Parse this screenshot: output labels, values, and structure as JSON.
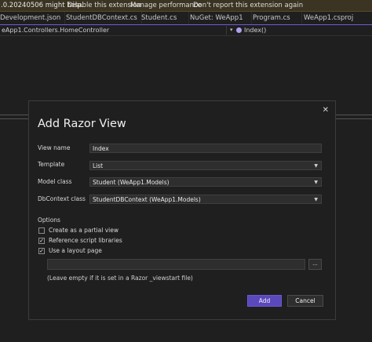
{
  "infobar": {
    "message": ".0.20240506 might help.",
    "links": [
      "Disable this extension",
      "Manage performance",
      "Don't report this extension again"
    ]
  },
  "tabs": [
    "Development.json",
    "StudentDBContext.cs",
    "Student.cs",
    "NuGet: WeApp1",
    "Program.cs",
    "WeApp1.csproj"
  ],
  "navbar": {
    "left": "eApp1.Controllers.HomeController",
    "right": "Index()"
  },
  "dialog": {
    "title": "Add Razor View",
    "close_glyph": "✕",
    "fields": {
      "view_name": {
        "label": "View name",
        "value": "Index"
      },
      "template": {
        "label": "Template",
        "value": "List"
      },
      "model_class": {
        "label": "Model class",
        "value": "Student (WeApp1.Models)"
      },
      "dbcontext_class": {
        "label": "DbContext class",
        "value": "StudentDBContext (WeApp1.Models)"
      }
    },
    "options": {
      "heading": "Options",
      "partial_view": {
        "label": "Create as a partial view",
        "checked": false
      },
      "script_libraries": {
        "label": "Reference script libraries",
        "checked": true
      },
      "layout_page": {
        "label": "Use a layout page",
        "checked": true
      }
    },
    "layout_path": "",
    "browse_label": "...",
    "hint": "(Leave empty if it is set in a Razor _viewstart file)",
    "add_label": "Add",
    "cancel_label": "Cancel"
  },
  "colors": {
    "accent": "#5a48bd",
    "background": "#1f1f1f",
    "infobar": "#3b3422"
  }
}
